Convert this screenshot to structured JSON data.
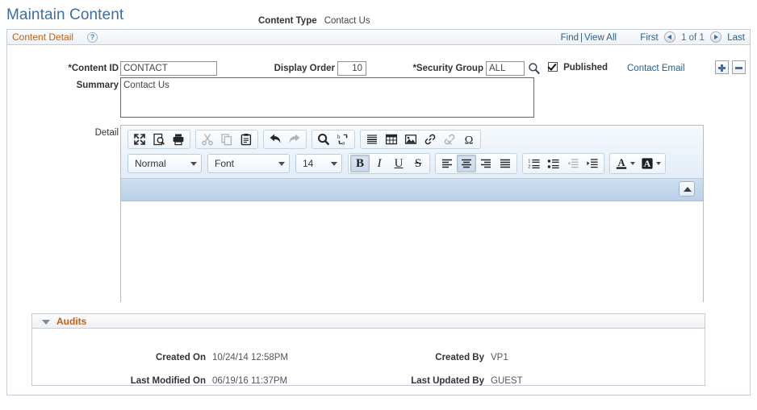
{
  "header": {
    "page_title": "Maintain Content",
    "content_type_label": "Content Type",
    "content_type_value": "Contact Us"
  },
  "content_detail": {
    "group_title": "Content Detail",
    "help_icon_text": "?",
    "nav": {
      "find": "Find",
      "separator": "|",
      "view_all": "View All",
      "first": "First",
      "page_count": "1 of 1",
      "last": "Last"
    },
    "fields": {
      "content_id_label": "*Content ID",
      "content_id_value": "CONTACT",
      "display_order_label": "Display Order",
      "display_order_value": "10",
      "security_group_label": "*Security Group",
      "security_group_value": "ALL",
      "published_label": "Published",
      "published_checked": true,
      "contact_email_link": "Contact Email",
      "summary_label": "Summary",
      "summary_value": "Contact Us",
      "detail_label": "Detail"
    },
    "row_buttons": {
      "add_label": "+",
      "delete_label": "-"
    }
  },
  "editor": {
    "toolbar_row1": [
      {
        "name": "maximize-icon",
        "title": "Maximize",
        "disabled": false
      },
      {
        "name": "preview-icon",
        "title": "Preview",
        "disabled": false
      },
      {
        "name": "print-icon",
        "title": "Print",
        "disabled": false
      },
      {
        "name": "cut-icon",
        "title": "Cut",
        "disabled": true
      },
      {
        "name": "copy-icon",
        "title": "Copy",
        "disabled": true
      },
      {
        "name": "paste-icon",
        "title": "Paste",
        "disabled": false
      },
      {
        "name": "undo-icon",
        "title": "Undo",
        "disabled": false
      },
      {
        "name": "redo-icon",
        "title": "Redo",
        "disabled": true
      },
      {
        "name": "find-icon",
        "title": "Find",
        "disabled": false
      },
      {
        "name": "replace-icon",
        "title": "Replace",
        "disabled": false
      },
      {
        "name": "horizontal-rule-icon",
        "title": "Horizontal Rule",
        "disabled": false
      },
      {
        "name": "table-icon",
        "title": "Table",
        "disabled": false
      },
      {
        "name": "image-icon",
        "title": "Image",
        "disabled": false
      },
      {
        "name": "link-icon",
        "title": "Link",
        "disabled": false
      },
      {
        "name": "unlink-icon",
        "title": "Unlink",
        "disabled": true
      },
      {
        "name": "special-character-icon",
        "title": "Special Character",
        "disabled": false
      }
    ],
    "combos": {
      "paragraph_style": "Normal",
      "font_family": "Font",
      "font_size": "14"
    },
    "format_buttons": {
      "bold": "B",
      "italic": "I",
      "underline": "U",
      "strikethrough": "S",
      "bold_active": true
    },
    "align_buttons": {
      "left": "align-left",
      "center": "align-center",
      "right": "align-right",
      "justify": "align-justify",
      "center_active": true
    },
    "list_buttons": {
      "numbered": "numbered-list",
      "bulleted": "bulleted-list",
      "outdent": "decrease-indent",
      "indent": "increase-indent",
      "outdent_disabled": true
    },
    "color_buttons": {
      "text_color_letter": "A",
      "background_color_letter": "A"
    },
    "body_html": "",
    "collapse_button_title": "Collapse Toolbar"
  },
  "audits": {
    "title": "Audits",
    "created_on_label": "Created On",
    "created_on_value": "10/24/14 12:58PM",
    "last_modified_on_label": "Last Modified On",
    "last_modified_on_value": "06/19/16 11:37PM",
    "created_by_label": "Created By",
    "created_by_value": "VP1",
    "last_updated_by_label": "Last Updated By",
    "last_updated_by_value": "GUEST"
  },
  "colors": {
    "title_blue": "#3b6ea5",
    "group_title_orange": "#c06014",
    "link_blue": "#2a5c90",
    "border_gray": "#c3ccd8",
    "editor_border": "#a7c0db",
    "band_blue": "#c3d8ec"
  }
}
